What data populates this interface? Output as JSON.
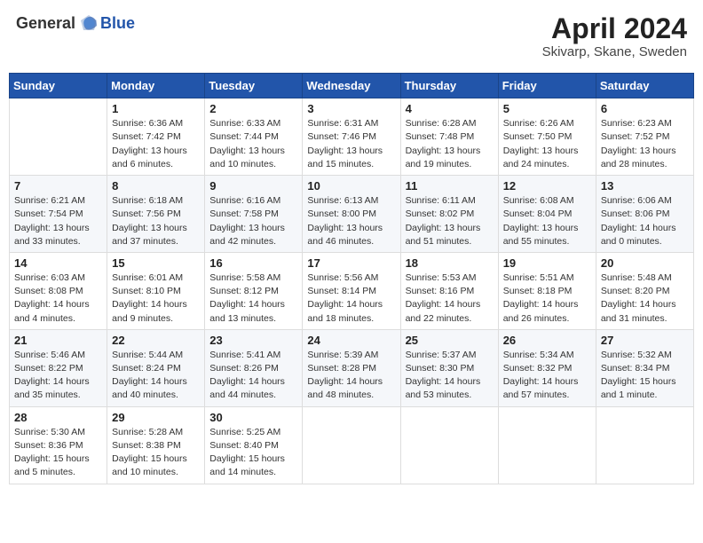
{
  "header": {
    "logo_general": "General",
    "logo_blue": "Blue",
    "month": "April 2024",
    "location": "Skivarp, Skane, Sweden"
  },
  "columns": [
    "Sunday",
    "Monday",
    "Tuesday",
    "Wednesday",
    "Thursday",
    "Friday",
    "Saturday"
  ],
  "weeks": [
    [
      {
        "num": "",
        "info": ""
      },
      {
        "num": "1",
        "info": "Sunrise: 6:36 AM\nSunset: 7:42 PM\nDaylight: 13 hours\nand 6 minutes."
      },
      {
        "num": "2",
        "info": "Sunrise: 6:33 AM\nSunset: 7:44 PM\nDaylight: 13 hours\nand 10 minutes."
      },
      {
        "num": "3",
        "info": "Sunrise: 6:31 AM\nSunset: 7:46 PM\nDaylight: 13 hours\nand 15 minutes."
      },
      {
        "num": "4",
        "info": "Sunrise: 6:28 AM\nSunset: 7:48 PM\nDaylight: 13 hours\nand 19 minutes."
      },
      {
        "num": "5",
        "info": "Sunrise: 6:26 AM\nSunset: 7:50 PM\nDaylight: 13 hours\nand 24 minutes."
      },
      {
        "num": "6",
        "info": "Sunrise: 6:23 AM\nSunset: 7:52 PM\nDaylight: 13 hours\nand 28 minutes."
      }
    ],
    [
      {
        "num": "7",
        "info": "Sunrise: 6:21 AM\nSunset: 7:54 PM\nDaylight: 13 hours\nand 33 minutes."
      },
      {
        "num": "8",
        "info": "Sunrise: 6:18 AM\nSunset: 7:56 PM\nDaylight: 13 hours\nand 37 minutes."
      },
      {
        "num": "9",
        "info": "Sunrise: 6:16 AM\nSunset: 7:58 PM\nDaylight: 13 hours\nand 42 minutes."
      },
      {
        "num": "10",
        "info": "Sunrise: 6:13 AM\nSunset: 8:00 PM\nDaylight: 13 hours\nand 46 minutes."
      },
      {
        "num": "11",
        "info": "Sunrise: 6:11 AM\nSunset: 8:02 PM\nDaylight: 13 hours\nand 51 minutes."
      },
      {
        "num": "12",
        "info": "Sunrise: 6:08 AM\nSunset: 8:04 PM\nDaylight: 13 hours\nand 55 minutes."
      },
      {
        "num": "13",
        "info": "Sunrise: 6:06 AM\nSunset: 8:06 PM\nDaylight: 14 hours\nand 0 minutes."
      }
    ],
    [
      {
        "num": "14",
        "info": "Sunrise: 6:03 AM\nSunset: 8:08 PM\nDaylight: 14 hours\nand 4 minutes."
      },
      {
        "num": "15",
        "info": "Sunrise: 6:01 AM\nSunset: 8:10 PM\nDaylight: 14 hours\nand 9 minutes."
      },
      {
        "num": "16",
        "info": "Sunrise: 5:58 AM\nSunset: 8:12 PM\nDaylight: 14 hours\nand 13 minutes."
      },
      {
        "num": "17",
        "info": "Sunrise: 5:56 AM\nSunset: 8:14 PM\nDaylight: 14 hours\nand 18 minutes."
      },
      {
        "num": "18",
        "info": "Sunrise: 5:53 AM\nSunset: 8:16 PM\nDaylight: 14 hours\nand 22 minutes."
      },
      {
        "num": "19",
        "info": "Sunrise: 5:51 AM\nSunset: 8:18 PM\nDaylight: 14 hours\nand 26 minutes."
      },
      {
        "num": "20",
        "info": "Sunrise: 5:48 AM\nSunset: 8:20 PM\nDaylight: 14 hours\nand 31 minutes."
      }
    ],
    [
      {
        "num": "21",
        "info": "Sunrise: 5:46 AM\nSunset: 8:22 PM\nDaylight: 14 hours\nand 35 minutes."
      },
      {
        "num": "22",
        "info": "Sunrise: 5:44 AM\nSunset: 8:24 PM\nDaylight: 14 hours\nand 40 minutes."
      },
      {
        "num": "23",
        "info": "Sunrise: 5:41 AM\nSunset: 8:26 PM\nDaylight: 14 hours\nand 44 minutes."
      },
      {
        "num": "24",
        "info": "Sunrise: 5:39 AM\nSunset: 8:28 PM\nDaylight: 14 hours\nand 48 minutes."
      },
      {
        "num": "25",
        "info": "Sunrise: 5:37 AM\nSunset: 8:30 PM\nDaylight: 14 hours\nand 53 minutes."
      },
      {
        "num": "26",
        "info": "Sunrise: 5:34 AM\nSunset: 8:32 PM\nDaylight: 14 hours\nand 57 minutes."
      },
      {
        "num": "27",
        "info": "Sunrise: 5:32 AM\nSunset: 8:34 PM\nDaylight: 15 hours\nand 1 minute."
      }
    ],
    [
      {
        "num": "28",
        "info": "Sunrise: 5:30 AM\nSunset: 8:36 PM\nDaylight: 15 hours\nand 5 minutes."
      },
      {
        "num": "29",
        "info": "Sunrise: 5:28 AM\nSunset: 8:38 PM\nDaylight: 15 hours\nand 10 minutes."
      },
      {
        "num": "30",
        "info": "Sunrise: 5:25 AM\nSunset: 8:40 PM\nDaylight: 15 hours\nand 14 minutes."
      },
      {
        "num": "",
        "info": ""
      },
      {
        "num": "",
        "info": ""
      },
      {
        "num": "",
        "info": ""
      },
      {
        "num": "",
        "info": ""
      }
    ]
  ]
}
